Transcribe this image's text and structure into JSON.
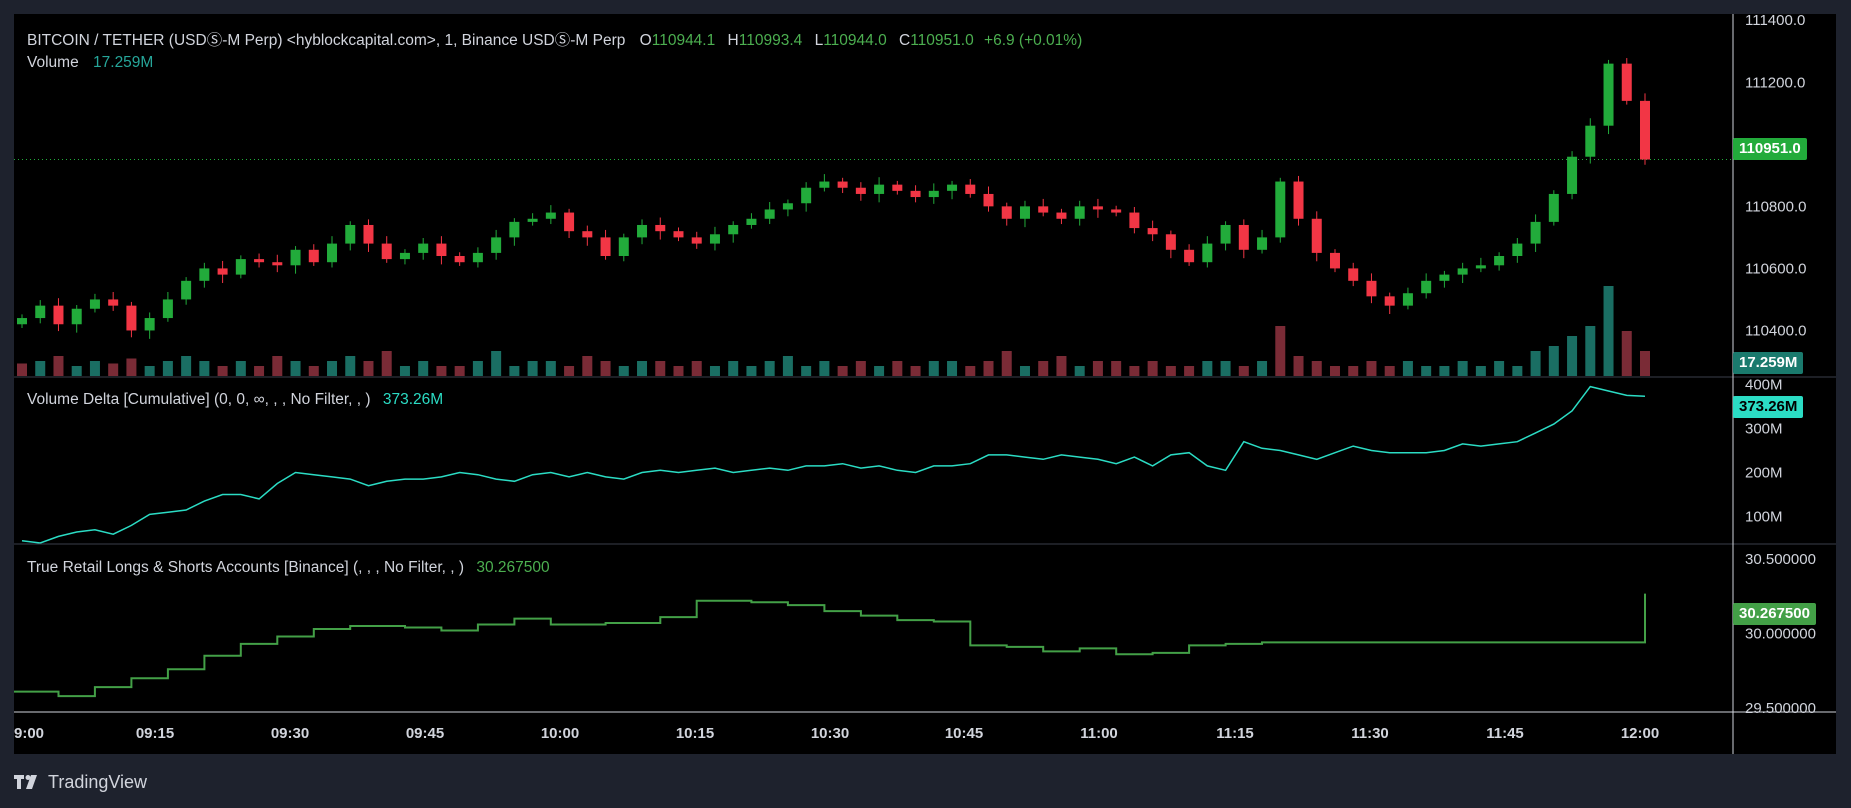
{
  "chart": {
    "symbol_line": "BITCOIN / TETHER (USDⓈ-M Perp) <hyblockcapital.com>, 1, Binance USDⓈ-M Perp",
    "ohlc": {
      "o_label": "O",
      "o": "110944.1",
      "h_label": "H",
      "h": "110993.4",
      "l_label": "L",
      "l": "110944.0",
      "c_label": "C",
      "c": "110951.0",
      "change": "+6.9 (+0.01%)"
    },
    "volume_label": "Volume",
    "volume_value": "17.259M",
    "price_badge": "110951.0",
    "volume_badge": "17.259M"
  },
  "delta": {
    "title": "Volume Delta [Cumulative] (0, 0, ∞, , , No Filter, , )",
    "value": "373.26M",
    "badge": "373.26M"
  },
  "retail": {
    "title": "True Retail Longs & Shorts Accounts [Binance] (, , , No Filter, , )",
    "value": "30.267500",
    "badge": "30.267500"
  },
  "brand": "TradingView",
  "colors": {
    "up": "#22ab3b",
    "down": "#f23645",
    "vol_up": "#1a6e63",
    "vol_down": "#7a2b36",
    "delta_line": "#2bdcc4",
    "retail_line": "#43a047"
  },
  "chart_data": [
    {
      "type": "candlestick",
      "title": "BITCOIN / TETHER (USDⓈ-M Perp) <hyblockcapital.com>, 1, Binance USDⓈ-M Perp",
      "x": [
        "09:03",
        "09:05",
        "09:07",
        "09:09",
        "09:11",
        "09:13",
        "09:15",
        "09:17",
        "09:19",
        "09:21",
        "09:23",
        "09:25",
        "09:27",
        "09:29",
        "09:31",
        "09:33",
        "09:35",
        "09:37",
        "09:39",
        "09:41",
        "09:43",
        "09:45",
        "09:47",
        "09:49",
        "09:51",
        "09:53",
        "09:55",
        "09:57",
        "09:59",
        "10:01",
        "10:03",
        "10:05",
        "10:07",
        "10:09",
        "10:11",
        "10:13",
        "10:15",
        "10:17",
        "10:19",
        "10:21",
        "10:23",
        "10:25",
        "10:27",
        "10:29",
        "10:31",
        "10:33",
        "10:35",
        "10:37",
        "10:39",
        "10:41",
        "10:43",
        "10:45",
        "10:47",
        "10:49",
        "10:51",
        "10:53",
        "10:55",
        "10:57",
        "10:59",
        "11:01",
        "11:03",
        "11:05",
        "11:07",
        "11:09",
        "11:11",
        "11:13",
        "11:15",
        "11:17",
        "11:19",
        "11:21",
        "11:23",
        "11:25",
        "11:27",
        "11:29",
        "11:31",
        "11:33",
        "11:35",
        "11:37",
        "11:39",
        "11:41",
        "11:43",
        "11:45",
        "11:47",
        "11:49",
        "11:51",
        "11:53",
        "11:55",
        "11:57",
        "11:59",
        "12:00"
      ],
      "close": [
        110440,
        110480,
        110420,
        110470,
        110500,
        110480,
        110400,
        110440,
        110500,
        110560,
        110600,
        110580,
        110630,
        110620,
        110610,
        110660,
        110620,
        110680,
        110740,
        110680,
        110630,
        110650,
        110680,
        110640,
        110620,
        110650,
        110700,
        110750,
        110760,
        110780,
        110720,
        110700,
        110640,
        110700,
        110740,
        110720,
        110700,
        110680,
        110710,
        110740,
        110760,
        110790,
        110810,
        110860,
        110880,
        110860,
        110840,
        110870,
        110850,
        110830,
        110850,
        110870,
        110840,
        110800,
        110760,
        110800,
        110780,
        110760,
        110800,
        110790,
        110780,
        110730,
        110710,
        110660,
        110620,
        110680,
        110740,
        110660,
        110700,
        110880,
        110760,
        110650,
        110600,
        110560,
        110510,
        110480,
        110520,
        110560,
        110580,
        110600,
        110610,
        110640,
        110680,
        110750,
        110840,
        110960,
        111060,
        111260,
        111140,
        110951
      ],
      "xlabel": "",
      "ylabel": "",
      "ylim": [
        110250,
        111420
      ],
      "yticks": [
        "111400.0",
        "111200.0",
        "111000.0",
        "110800.0",
        "110600.0",
        "110400.0"
      ]
    },
    {
      "type": "bar",
      "title": "Volume",
      "values": [
        2.5,
        3,
        4,
        2,
        3,
        2.5,
        3.5,
        2,
        3,
        4,
        3,
        2,
        3,
        2,
        4,
        3,
        2,
        3,
        4,
        3,
        5,
        2,
        3,
        2,
        2,
        3,
        5,
        2,
        3,
        3,
        2,
        4,
        3,
        2,
        3,
        3,
        2,
        3,
        2,
        3,
        2,
        3,
        4,
        2,
        3,
        2,
        3,
        2,
        3,
        2,
        3,
        3,
        2,
        3,
        5,
        2,
        3,
        4,
        2,
        3,
        3,
        2,
        3,
        2,
        2,
        3,
        3,
        2,
        3,
        10,
        4,
        3,
        2,
        2,
        3,
        2,
        3,
        2,
        2,
        3,
        2,
        3,
        2,
        5,
        6,
        8,
        10,
        18,
        9,
        5
      ],
      "direction": [
        "d",
        "u",
        "d",
        "u",
        "u",
        "d",
        "d",
        "u",
        "u",
        "u",
        "u",
        "d",
        "u",
        "d",
        "d",
        "u",
        "d",
        "u",
        "u",
        "d",
        "d",
        "u",
        "u",
        "d",
        "d",
        "u",
        "u",
        "u",
        "u",
        "u",
        "d",
        "d",
        "d",
        "u",
        "u",
        "d",
        "d",
        "d",
        "u",
        "u",
        "u",
        "u",
        "u",
        "u",
        "u",
        "d",
        "d",
        "u",
        "d",
        "d",
        "u",
        "u",
        "d",
        "d",
        "d",
        "u",
        "d",
        "d",
        "u",
        "d",
        "d",
        "d",
        "d",
        "d",
        "d",
        "u",
        "u",
        "d",
        "u",
        "d",
        "d",
        "d",
        "d",
        "d",
        "d",
        "d",
        "u",
        "u",
        "u",
        "u",
        "u",
        "u",
        "u",
        "u",
        "u",
        "u",
        "u",
        "u",
        "d",
        "d"
      ]
    },
    {
      "type": "line",
      "title": "Volume Delta [Cumulative] (0, 0, ∞, , , No Filter, , )",
      "series": [
        {
          "values": [
            45,
            40,
            55,
            65,
            70,
            60,
            80,
            105,
            110,
            115,
            135,
            150,
            150,
            140,
            175,
            200,
            195,
            190,
            185,
            170,
            180,
            185,
            185,
            190,
            200,
            195,
            185,
            180,
            195,
            200,
            190,
            200,
            190,
            185,
            200,
            205,
            200,
            205,
            210,
            200,
            205,
            210,
            205,
            215,
            215,
            220,
            210,
            215,
            205,
            200,
            215,
            215,
            220,
            240,
            240,
            235,
            230,
            240,
            235,
            230,
            220,
            235,
            215,
            240,
            245,
            215,
            205,
            270,
            255,
            250,
            240,
            230,
            245,
            260,
            250,
            245,
            245,
            245,
            250,
            265,
            260,
            265,
            270,
            290,
            310,
            340,
            395,
            385,
            375,
            373.26
          ]
        }
      ],
      "ylim": [
        40,
        410
      ],
      "yticks": [
        "400M",
        "300M",
        "200M",
        "100M"
      ]
    },
    {
      "type": "line",
      "title": "True Retail Longs & Shorts Accounts [Binance] (, , , No Filter, , )",
      "series": [
        {
          "values": [
            29.61,
            29.61,
            29.58,
            29.58,
            29.64,
            29.64,
            29.7,
            29.7,
            29.76,
            29.76,
            29.85,
            29.85,
            29.93,
            29.93,
            29.98,
            29.98,
            30.03,
            30.03,
            30.05,
            30.05,
            30.05,
            30.04,
            30.04,
            30.02,
            30.02,
            30.06,
            30.06,
            30.1,
            30.1,
            30.06,
            30.06,
            30.06,
            30.07,
            30.07,
            30.07,
            30.11,
            30.11,
            30.22,
            30.22,
            30.22,
            30.21,
            30.21,
            30.19,
            30.19,
            30.15,
            30.15,
            30.12,
            30.12,
            30.09,
            30.09,
            30.08,
            30.08,
            29.92,
            29.92,
            29.91,
            29.91,
            29.88,
            29.88,
            29.9,
            29.9,
            29.86,
            29.86,
            29.87,
            29.87,
            29.92,
            29.92,
            29.93,
            29.93,
            29.94,
            29.94,
            29.94,
            29.94,
            29.94,
            29.94,
            29.94,
            29.94,
            29.94,
            29.94,
            29.94,
            29.94,
            29.94,
            29.94,
            29.94,
            29.94,
            29.94,
            29.94,
            29.94,
            29.94,
            29.94,
            30.2675
          ]
        }
      ],
      "ylim": [
        29.48,
        30.58
      ],
      "yticks": [
        "30.500000",
        "30.000000",
        "29.500000"
      ]
    }
  ],
  "time_axis": [
    "9:00",
    "09:15",
    "09:30",
    "09:45",
    "10:00",
    "10:15",
    "10:30",
    "10:45",
    "11:00",
    "11:15",
    "11:30",
    "11:45",
    "12:00"
  ]
}
